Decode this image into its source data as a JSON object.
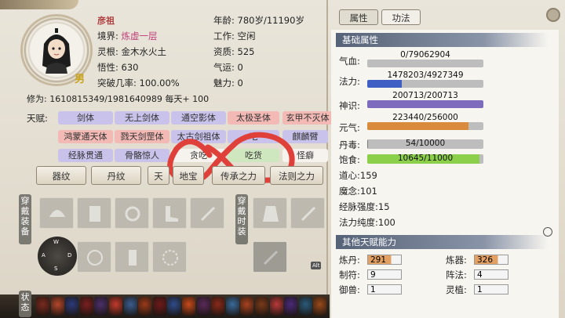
{
  "character": {
    "name": "彦祖",
    "gender": "男",
    "realm_label": "境界:",
    "realm": "炼虚一层",
    "root_label": "灵根:",
    "root": "金木水火土",
    "wisdom_label": "悟性:",
    "wisdom": "630",
    "break_label": "突破几率:",
    "break": "100.00%",
    "age_label": "年龄:",
    "age": "780岁/11190岁",
    "job_label": "工作:",
    "job": "空闲",
    "aptitude_label": "资质:",
    "aptitude": "525",
    "luck_label": "气运:",
    "luck": "0",
    "charm_label": "魅力:",
    "charm": "0",
    "cult_label": "修为:",
    "cult": "1610815349/1981640989",
    "per_day": "每天+ 100"
  },
  "talents": {
    "label": "天赋:",
    "items": [
      {
        "text": "剑体",
        "color": "purple"
      },
      {
        "text": "无上剑体",
        "color": "purple"
      },
      {
        "text": "通空影体",
        "color": "purple"
      },
      {
        "text": "太极圣体",
        "color": "red"
      },
      {
        "text": "玄甲不灭体",
        "color": "red"
      },
      {
        "text": "鸿蒙通天体",
        "color": "red"
      },
      {
        "text": "戮天剑罡体",
        "color": "red"
      },
      {
        "text": "太古剑祖体",
        "color": "purple"
      },
      {
        "text": "吃",
        "color": "purple"
      },
      {
        "text": "麒麟臂",
        "color": "purple"
      },
      {
        "text": "经脉贯通",
        "color": "purple"
      },
      {
        "text": "骨骼惊人",
        "color": "purple"
      },
      {
        "text": "贪吃",
        "color": "white"
      },
      {
        "text": "吃货",
        "color": "green"
      },
      {
        "text": "怪癖",
        "color": "white"
      }
    ]
  },
  "tabs": [
    "器纹",
    "丹纹",
    "天",
    "地宝",
    "传承之力",
    "法则之力"
  ],
  "equip_label": "穿戴装备",
  "clothes_label": "穿戴时装",
  "status_label": "状态",
  "keys": [
    "W",
    "A",
    "S",
    "D"
  ],
  "alt_label": "Alt",
  "top_buttons": [
    "属性",
    "功法"
  ],
  "basic": {
    "header": "基础属性",
    "bars": [
      {
        "label": "气血:",
        "text": "0/79062904",
        "fill": 0.0,
        "color": "#c94a3b"
      },
      {
        "label": "法力:",
        "text": "1478203/4927349",
        "fill": 0.3,
        "color": "#3f5fc4"
      },
      {
        "label": "神识:",
        "text": "200713/200713",
        "fill": 1.0,
        "color": "#7f6bbd"
      },
      {
        "label": "元气:",
        "text": "223440/256000",
        "fill": 0.873,
        "color": "#d98a3c"
      },
      {
        "label": "丹毒:",
        "text": "54/10000",
        "fill": 0.0054,
        "color": "#7a7a7a"
      },
      {
        "label": "饱食:",
        "text": "10645/11000",
        "fill": 0.968,
        "color": "#8ccf4a"
      }
    ],
    "stats": [
      {
        "label": "道心:",
        "value": "159"
      },
      {
        "label": "魔念:",
        "value": "101"
      },
      {
        "label": "经脉强度:",
        "value": "15"
      },
      {
        "label": "法力纯度:",
        "value": "100"
      }
    ]
  },
  "other": {
    "header": "其他天赋能力",
    "rows": [
      {
        "l_label": "炼丹:",
        "l_value": "291",
        "r_label": "炼器:",
        "r_value": "326"
      },
      {
        "l_label": "制符:",
        "l_value": "9",
        "r_label": "阵法:",
        "r_value": "4"
      },
      {
        "l_label": "御兽:",
        "l_value": "1",
        "r_label": "灵植:",
        "r_value": "1"
      }
    ]
  }
}
